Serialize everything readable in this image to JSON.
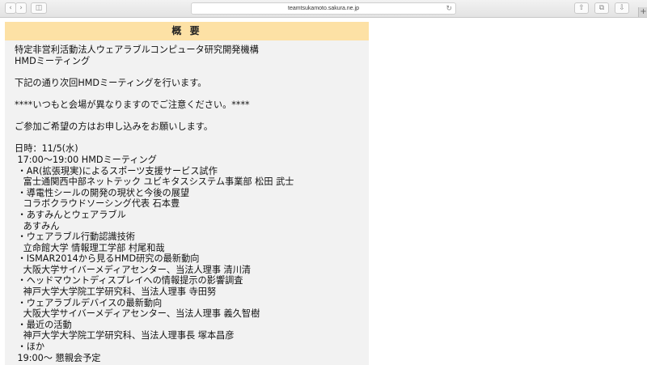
{
  "browser": {
    "url": "teamtsukamoto.sakura.ne.jp",
    "reload_icon": "reload-icon",
    "back_icon": "chevron-left-icon",
    "forward_icon": "chevron-right-icon"
  },
  "panel": {
    "title": "概 要",
    "lines": [
      "特定非営利活動法人ウェアラブルコンピュータ研究開発機構",
      "HMDミーティング",
      "",
      "下記の通り次回HMDミーティングを行います。",
      "",
      "****いつもと会場が異なりますのでご注意ください。****",
      "",
      "ご参加ご希望の方はお申し込みをお願いします。",
      "",
      "日時：11/5(水)",
      " 17:00～19:00 HMDミーティング",
      " ・AR(拡張現実)によるスポーツ支援サービス試作",
      "   富士通関西中部ネットテック ユビキタスシステム事業部 松田 武士",
      " ・導電性シールの開発の現状と今後の展望",
      "   コラボクラウドソーシング代表 石本豊",
      " ・あすみんとウェアラブル",
      "   あすみん",
      " ・ウェアラブル行動認識技術",
      "   立命館大学 情報理工学部 村尾和哉",
      " ・ISMAR2014から見るHMD研究の最新動向",
      "   大阪大学サイバーメディアセンター、当法人理事 清川清",
      " ・ヘッドマウントディスプレイへの情報提示の影響調査",
      "   神戸大学大学院工学研究科、当法人理事 寺田努",
      " ・ウェアラブルデバイスの最新動向",
      "   大阪大学サイバーメディアセンター、当法人理事 義久智樹",
      " ・最近の活動",
      "   神戸大学大学院工学研究科、当法人理事長 塚本昌彦",
      " ・ほか",
      " 19:00～ 懇親会予定"
    ]
  }
}
